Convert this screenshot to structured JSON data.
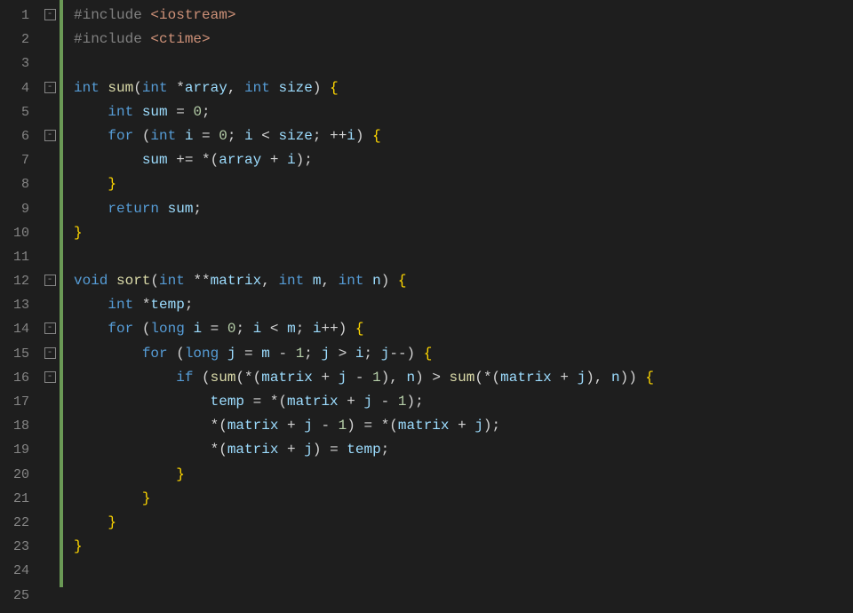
{
  "editor": {
    "lines": [
      {
        "num": "1",
        "fold": "-",
        "tokens": [
          [
            "pp",
            "#include "
          ],
          [
            "inc",
            "<iostream>"
          ]
        ]
      },
      {
        "num": "2",
        "fold": "",
        "tokens": [
          [
            "pp",
            "#include "
          ],
          [
            "inc",
            "<ctime>"
          ]
        ]
      },
      {
        "num": "3",
        "fold": "",
        "tokens": []
      },
      {
        "num": "4",
        "fold": "-",
        "tokens": [
          [
            "type",
            "int "
          ],
          [
            "func",
            "sum"
          ],
          [
            "punct",
            "("
          ],
          [
            "type",
            "int "
          ],
          [
            "op",
            "*"
          ],
          [
            "param",
            "array"
          ],
          [
            "punct",
            ", "
          ],
          [
            "type",
            "int "
          ],
          [
            "param",
            "size"
          ],
          [
            "punct",
            ") "
          ],
          [
            "bracket",
            "{"
          ]
        ]
      },
      {
        "num": "5",
        "fold": "",
        "tokens": [
          [
            "punct",
            "    "
          ],
          [
            "type",
            "int "
          ],
          [
            "var",
            "sum"
          ],
          [
            "punct",
            " = "
          ],
          [
            "num",
            "0"
          ],
          [
            "punct",
            ";"
          ]
        ]
      },
      {
        "num": "6",
        "fold": "-",
        "tokens": [
          [
            "punct",
            "    "
          ],
          [
            "kw",
            "for"
          ],
          [
            "punct",
            " ("
          ],
          [
            "type",
            "int "
          ],
          [
            "var",
            "i"
          ],
          [
            "punct",
            " = "
          ],
          [
            "num",
            "0"
          ],
          [
            "punct",
            "; "
          ],
          [
            "var",
            "i"
          ],
          [
            "punct",
            " < "
          ],
          [
            "param",
            "size"
          ],
          [
            "punct",
            "; ++"
          ],
          [
            "var",
            "i"
          ],
          [
            "punct",
            ") "
          ],
          [
            "bracket",
            "{"
          ]
        ]
      },
      {
        "num": "7",
        "fold": "",
        "tokens": [
          [
            "punct",
            "        "
          ],
          [
            "var",
            "sum"
          ],
          [
            "punct",
            " += *("
          ],
          [
            "param",
            "array"
          ],
          [
            "punct",
            " + "
          ],
          [
            "var",
            "i"
          ],
          [
            "punct",
            ");"
          ]
        ]
      },
      {
        "num": "8",
        "fold": "",
        "tokens": [
          [
            "punct",
            "    "
          ],
          [
            "bracket",
            "}"
          ]
        ]
      },
      {
        "num": "9",
        "fold": "",
        "tokens": [
          [
            "punct",
            "    "
          ],
          [
            "kw",
            "return"
          ],
          [
            "punct",
            " "
          ],
          [
            "var",
            "sum"
          ],
          [
            "punct",
            ";"
          ]
        ]
      },
      {
        "num": "10",
        "fold": "",
        "tokens": [
          [
            "bracket",
            "}"
          ]
        ]
      },
      {
        "num": "11",
        "fold": "",
        "tokens": []
      },
      {
        "num": "12",
        "fold": "-",
        "tokens": [
          [
            "type",
            "void "
          ],
          [
            "func",
            "sort"
          ],
          [
            "punct",
            "("
          ],
          [
            "type",
            "int "
          ],
          [
            "op",
            "**"
          ],
          [
            "param",
            "matrix"
          ],
          [
            "punct",
            ", "
          ],
          [
            "type",
            "int "
          ],
          [
            "param",
            "m"
          ],
          [
            "punct",
            ", "
          ],
          [
            "type",
            "int "
          ],
          [
            "param",
            "n"
          ],
          [
            "punct",
            ") "
          ],
          [
            "bracket",
            "{"
          ]
        ]
      },
      {
        "num": "13",
        "fold": "",
        "tokens": [
          [
            "punct",
            "    "
          ],
          [
            "type",
            "int "
          ],
          [
            "op",
            "*"
          ],
          [
            "var",
            "temp"
          ],
          [
            "punct",
            ";"
          ]
        ]
      },
      {
        "num": "14",
        "fold": "-",
        "tokens": [
          [
            "punct",
            "    "
          ],
          [
            "kw",
            "for"
          ],
          [
            "punct",
            " ("
          ],
          [
            "type",
            "long "
          ],
          [
            "var",
            "i"
          ],
          [
            "punct",
            " = "
          ],
          [
            "num",
            "0"
          ],
          [
            "punct",
            "; "
          ],
          [
            "var",
            "i"
          ],
          [
            "punct",
            " < "
          ],
          [
            "param",
            "m"
          ],
          [
            "punct",
            "; "
          ],
          [
            "var",
            "i"
          ],
          [
            "punct",
            "++) "
          ],
          [
            "bracket",
            "{"
          ]
        ]
      },
      {
        "num": "15",
        "fold": "-",
        "tokens": [
          [
            "punct",
            "        "
          ],
          [
            "kw",
            "for"
          ],
          [
            "punct",
            " ("
          ],
          [
            "type",
            "long "
          ],
          [
            "var",
            "j"
          ],
          [
            "punct",
            " = "
          ],
          [
            "param",
            "m"
          ],
          [
            "punct",
            " - "
          ],
          [
            "num",
            "1"
          ],
          [
            "punct",
            "; "
          ],
          [
            "var",
            "j"
          ],
          [
            "punct",
            " > "
          ],
          [
            "var",
            "i"
          ],
          [
            "punct",
            "; "
          ],
          [
            "var",
            "j"
          ],
          [
            "punct",
            "--) "
          ],
          [
            "bracket",
            "{"
          ]
        ]
      },
      {
        "num": "16",
        "fold": "-",
        "tokens": [
          [
            "punct",
            "            "
          ],
          [
            "kw",
            "if"
          ],
          [
            "punct",
            " ("
          ],
          [
            "func",
            "sum"
          ],
          [
            "punct",
            "(*("
          ],
          [
            "param",
            "matrix"
          ],
          [
            "punct",
            " + "
          ],
          [
            "var",
            "j"
          ],
          [
            "punct",
            " - "
          ],
          [
            "num",
            "1"
          ],
          [
            "punct",
            "), "
          ],
          [
            "param",
            "n"
          ],
          [
            "punct",
            ") > "
          ],
          [
            "func",
            "sum"
          ],
          [
            "punct",
            "(*("
          ],
          [
            "param",
            "matrix"
          ],
          [
            "punct",
            " + "
          ],
          [
            "var",
            "j"
          ],
          [
            "punct",
            "), "
          ],
          [
            "param",
            "n"
          ],
          [
            "punct",
            ")) "
          ],
          [
            "bracket",
            "{"
          ]
        ]
      },
      {
        "num": "17",
        "fold": "",
        "tokens": [
          [
            "punct",
            "                "
          ],
          [
            "var",
            "temp"
          ],
          [
            "punct",
            " = *("
          ],
          [
            "param",
            "matrix"
          ],
          [
            "punct",
            " + "
          ],
          [
            "var",
            "j"
          ],
          [
            "punct",
            " - "
          ],
          [
            "num",
            "1"
          ],
          [
            "punct",
            ");"
          ]
        ]
      },
      {
        "num": "18",
        "fold": "",
        "tokens": [
          [
            "punct",
            "                *("
          ],
          [
            "param",
            "matrix"
          ],
          [
            "punct",
            " + "
          ],
          [
            "var",
            "j"
          ],
          [
            "punct",
            " - "
          ],
          [
            "num",
            "1"
          ],
          [
            "punct",
            ") = *("
          ],
          [
            "param",
            "matrix"
          ],
          [
            "punct",
            " + "
          ],
          [
            "var",
            "j"
          ],
          [
            "punct",
            ");"
          ]
        ]
      },
      {
        "num": "19",
        "fold": "",
        "tokens": [
          [
            "punct",
            "                *("
          ],
          [
            "param",
            "matrix"
          ],
          [
            "punct",
            " + "
          ],
          [
            "var",
            "j"
          ],
          [
            "punct",
            ") = "
          ],
          [
            "var",
            "temp"
          ],
          [
            "punct",
            ";"
          ]
        ]
      },
      {
        "num": "20",
        "fold": "",
        "tokens": [
          [
            "punct",
            "            "
          ],
          [
            "bracket",
            "}"
          ]
        ]
      },
      {
        "num": "21",
        "fold": "",
        "tokens": [
          [
            "punct",
            "        "
          ],
          [
            "bracket",
            "}"
          ]
        ]
      },
      {
        "num": "22",
        "fold": "",
        "tokens": [
          [
            "punct",
            "    "
          ],
          [
            "bracket",
            "}"
          ]
        ]
      },
      {
        "num": "23",
        "fold": "",
        "tokens": [
          [
            "bracket",
            "}"
          ]
        ]
      },
      {
        "num": "24",
        "fold": "",
        "tokens": []
      },
      {
        "num": "25",
        "fold": "",
        "tokens": []
      }
    ],
    "change_bar_end": 24
  }
}
